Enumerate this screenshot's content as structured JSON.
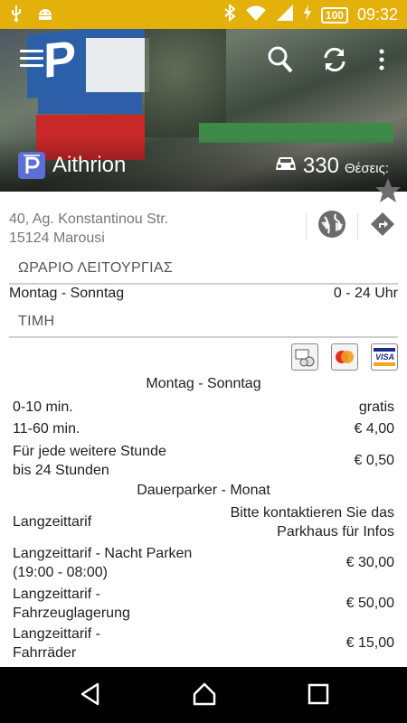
{
  "status_bar": {
    "time": "09:32",
    "battery": "100",
    "icons": [
      "usb-icon",
      "android-icon",
      "bluetooth-icon",
      "wifi-icon",
      "signal-icon",
      "charging-icon"
    ]
  },
  "header": {
    "parking_name": "Aithrion",
    "spaces": "330",
    "spaces_label": "Θέσεις:"
  },
  "address": {
    "line1": "40, Ag. Konstantinou Str.",
    "line2": "15124 Marousi"
  },
  "opening_hours": {
    "title": "ΩΡΑΡΙΟ ΛΕΙΤΟΥΡΓΙΑΣ",
    "days": "Montag - Sonntag",
    "hours": "0 - 24 Uhr"
  },
  "price": {
    "title": "ΤΙΜΗ",
    "payment_methods": [
      "coins-card-icon",
      "mastercard-icon",
      "visa-icon"
    ],
    "visa_label": "VISA",
    "group1_title": "Montag - Sonntag",
    "rows": [
      {
        "label": "0-10 min.",
        "value": "gratis"
      },
      {
        "label": "11-60 min.",
        "value": "€ 4,00"
      },
      {
        "label": "Für jede weitere Stunde",
        "label2": "bis 24 Stunden",
        "value": "€ 0,50"
      }
    ],
    "group2_title": "Dauerparker - Monat",
    "long_rows": [
      {
        "label": "Langzeittarif",
        "value": "Bitte kontaktieren Sie das",
        "value2": "Parkhaus für Infos"
      },
      {
        "label": "Langzeittarif - Nacht Parken",
        "label2": "(19:00 - 08:00)",
        "value": "€ 30,00"
      },
      {
        "label": "Langzeittarif -",
        "label2": "Fahrzeuglagerung",
        "value": "€ 50,00"
      },
      {
        "label": "Langzeittarif -",
        "label2": "Fahrräder",
        "value": "€ 15,00"
      }
    ]
  },
  "colors": {
    "status_bar": "#e3b10a",
    "accent_badge": "#5b6fd6"
  }
}
